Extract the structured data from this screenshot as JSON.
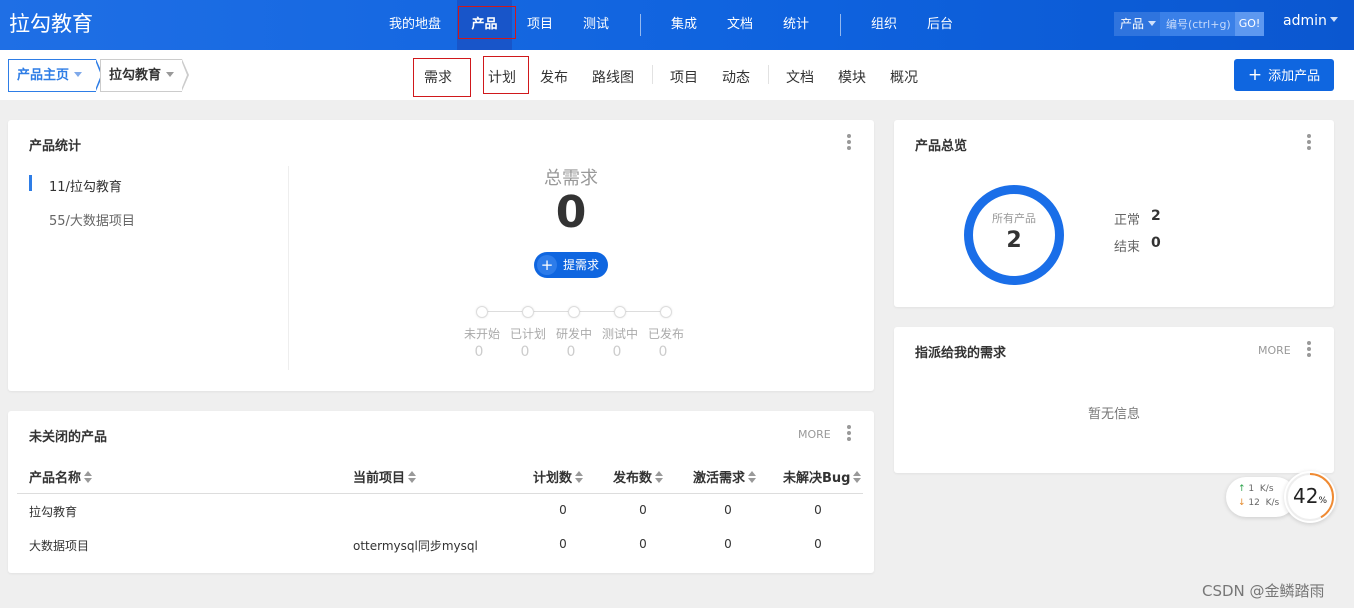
{
  "brand": "拉勾教育",
  "topnav": [
    {
      "label": "我的地盘",
      "active": false
    },
    {
      "label": "产品",
      "active": true
    },
    {
      "label": "项目",
      "active": false
    },
    {
      "label": "测试",
      "active": false
    },
    {
      "label": "集成",
      "active": false
    },
    {
      "label": "文档",
      "active": false
    },
    {
      "label": "统计",
      "active": false
    },
    {
      "label": "组织",
      "active": false
    },
    {
      "label": "后台",
      "active": false
    }
  ],
  "search": {
    "type": "产品",
    "placeholder": "编号(ctrl+g)",
    "go": "GO!"
  },
  "user": "admin",
  "breadcrumb": {
    "home": "产品主页",
    "product": "拉勾教育"
  },
  "subnav": [
    "需求",
    "计划",
    "发布",
    "路线图",
    "项目",
    "动态",
    "文档",
    "模块",
    "概况"
  ],
  "add_product": "添加产品",
  "stats": {
    "title": "产品统计",
    "products": [
      "11/拉勾教育",
      "55/大数据项目"
    ],
    "total_label": "总需求",
    "total": "0",
    "request_button": "提需求",
    "stages": [
      {
        "label": "未开始",
        "value": "0"
      },
      {
        "label": "已计划",
        "value": "0"
      },
      {
        "label": "研发中",
        "value": "0"
      },
      {
        "label": "测试中",
        "value": "0"
      },
      {
        "label": "已发布",
        "value": "0"
      }
    ]
  },
  "open_products": {
    "title": "未关闭的产品",
    "more": "MORE",
    "columns": [
      "产品名称",
      "当前项目",
      "计划数",
      "发布数",
      "激活需求",
      "未解决Bug"
    ],
    "rows": [
      [
        "拉勾教育",
        "",
        "0",
        "0",
        "0",
        "0"
      ],
      [
        "大数据项目",
        "ottermysql同步mysql",
        "0",
        "0",
        "0",
        "0"
      ]
    ]
  },
  "overview": {
    "title": "产品总览",
    "ring_label": "所有产品",
    "ring_value": "2",
    "normal_label": "正常",
    "normal_value": "2",
    "closed_label": "结束",
    "closed_value": "0",
    "ring_color": "#1a6ee8"
  },
  "assigned": {
    "title": "指派给我的需求",
    "more": "MORE",
    "empty": "暂无信息"
  },
  "netspeed": {
    "up": "1",
    "up_unit": "K/s",
    "down": "12",
    "down_unit": "K/s"
  },
  "gauge": {
    "value": "42",
    "unit": "%",
    "fraction": 0.42
  },
  "watermark": "CSDN @金鳞踏雨",
  "accent": "#0f66e0"
}
